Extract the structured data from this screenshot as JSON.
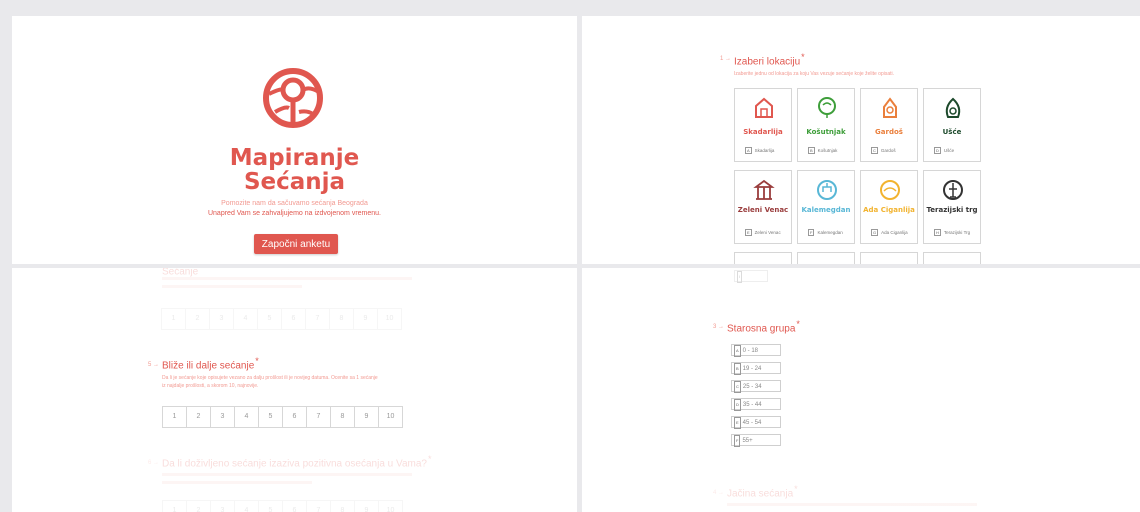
{
  "welcome": {
    "title_line1": "Mapiranje",
    "title_line2": "Sećanja",
    "subtitle1": "Pomozite nam da sačuvamo sećanja Beograda",
    "subtitle2": "Unapred Vam se zahvaljujemo na izdvojenom vremenu.",
    "start_button": "Započni anketu"
  },
  "location_question": {
    "number": "1 →",
    "title": "Izaberi lokaciju",
    "required": "*",
    "description": "Izaberite jednu od lokacija za koju Vas vezuje sećanje koje želite opisati.",
    "options": [
      {
        "name": "Skadarlija",
        "key": "A",
        "label": "Skadarlija",
        "color": "#e0574f",
        "icon": "house-icon"
      },
      {
        "name": "Košutnjak",
        "key": "B",
        "label": "Košutnjak",
        "color": "#3e9e3a",
        "icon": "tree-icon"
      },
      {
        "name": "Gardoš",
        "key": "C",
        "label": "Gardoš",
        "color": "#ea7f3c",
        "icon": "tower-icon"
      },
      {
        "name": "Ušće",
        "key": "D",
        "label": "Ušće",
        "color": "#1d4a2c",
        "icon": "leaf-icon"
      },
      {
        "name": "Zeleni Venac",
        "key": "E",
        "label": "Zeleni Venac",
        "color": "#9a3d3d",
        "icon": "pavilion-icon"
      },
      {
        "name": "Kalemegdan",
        "key": "F",
        "label": "Kalemegdan",
        "color": "#58b7d6",
        "icon": "fortress-icon"
      },
      {
        "name": "Ada Ciganlija",
        "key": "G",
        "label": "Ada Ciganlija",
        "color": "#f2b32f",
        "icon": "sun-icon"
      },
      {
        "name": "Terazijski trg",
        "key": "H",
        "label": "Terazijski Trg",
        "color": "#333333",
        "icon": "fountain-icon"
      }
    ],
    "partial_option_key": "I"
  },
  "memory_question_prev": {
    "title": "Sećanje",
    "required": "*"
  },
  "memory_question": {
    "number": "5 →",
    "title": "Bliže ili dalje sećanje",
    "required": "*",
    "description_line1": "Da li je sećanje koje opisujete vezano za dalju prošlost ili je novijeg datuma. Ocenite sa 1 sećanje",
    "description_line2": "iz najdalje prošlosti, a skorom 10, najnovije.",
    "scale": [
      "1",
      "2",
      "3",
      "4",
      "5",
      "6",
      "7",
      "8",
      "9",
      "10"
    ]
  },
  "memory_question_next": {
    "number": "6 →",
    "title": "Da li doživljeno sećanje izaziva pozitivna osećanja u Vama?",
    "required": "*"
  },
  "age_question": {
    "number": "3 →",
    "title": "Starosna grupa",
    "required": "*",
    "options": [
      {
        "key": "A",
        "label": "0 - 18"
      },
      {
        "key": "B",
        "label": "19 - 24"
      },
      {
        "key": "C",
        "label": "25 - 34"
      },
      {
        "key": "D",
        "label": "35 - 44"
      },
      {
        "key": "E",
        "label": "45 - 54"
      },
      {
        "key": "F",
        "label": "55+"
      }
    ]
  },
  "next_question": {
    "number": "4 →",
    "title": "Jačina sećanja",
    "required": "*"
  },
  "colors": {
    "brand": "#e0574f",
    "brand_light": "#f29a92",
    "background": "#e9e9ec"
  }
}
